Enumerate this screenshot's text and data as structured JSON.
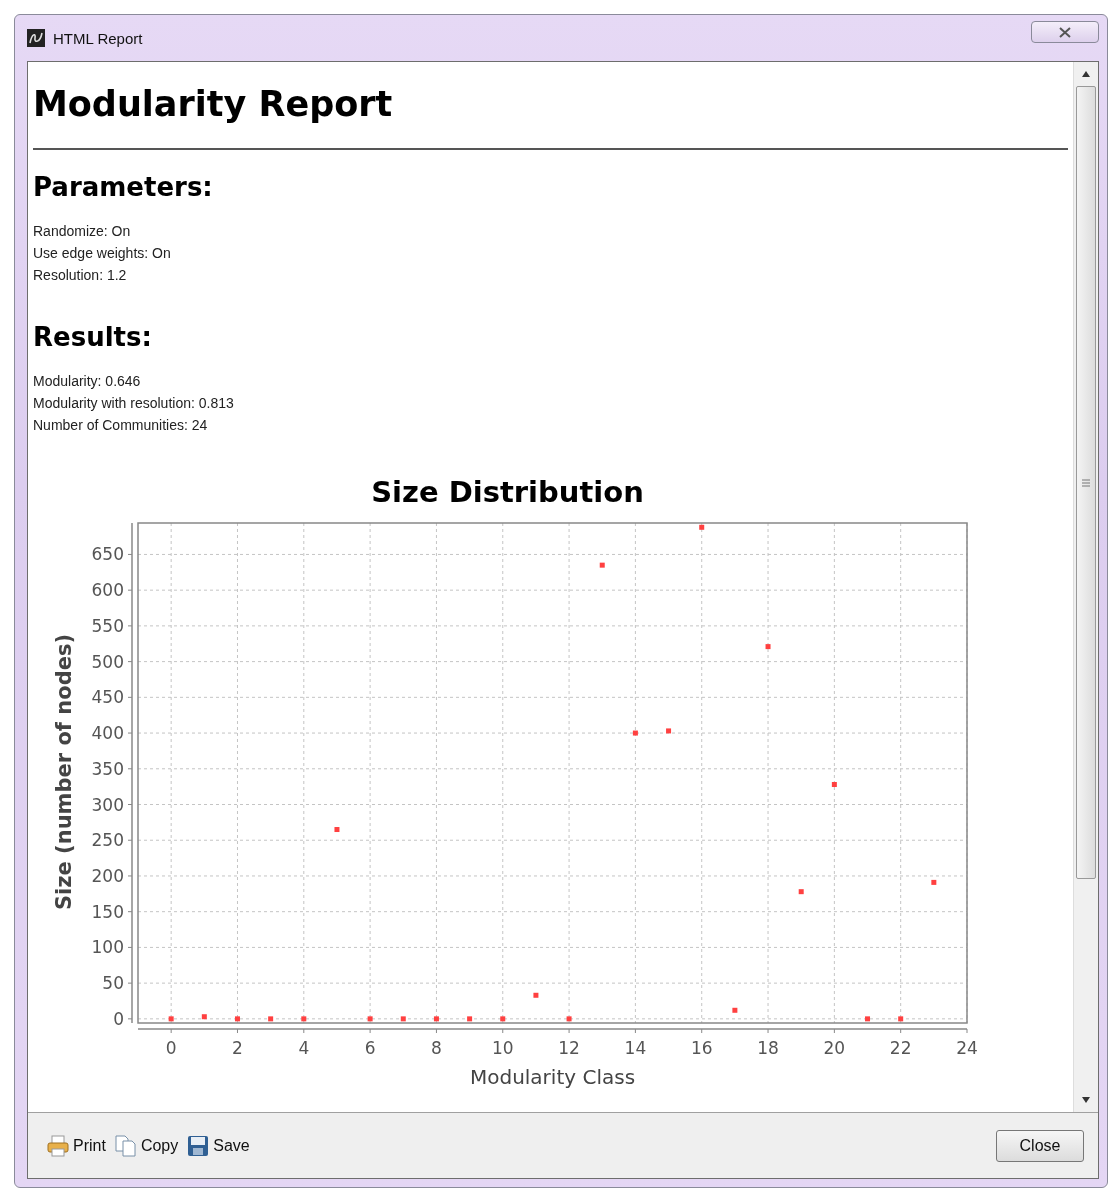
{
  "window": {
    "title": "HTML Report"
  },
  "report": {
    "title": "Modularity Report",
    "sections": [
      {
        "heading": "Parameters:",
        "lines": [
          "Randomize: On",
          "Use edge weights: On",
          "Resolution: 1.2"
        ]
      },
      {
        "heading": "Results:",
        "lines": [
          "Modularity: 0.646",
          "Modularity with resolution: 0.813",
          "Number of Communities: 24"
        ]
      }
    ],
    "chart_data": {
      "type": "scatter",
      "title": "Size Distribution",
      "xlabel": "Modularity Class",
      "ylabel": "Size (number of nodes)",
      "x": [
        0,
        1,
        2,
        3,
        4,
        5,
        6,
        7,
        8,
        9,
        10,
        11,
        12,
        13,
        14,
        15,
        16,
        17,
        18,
        19,
        20,
        21,
        22,
        23
      ],
      "grid": true,
      "series": [
        {
          "color": "#ff4040",
          "values": [
            0,
            3,
            0,
            0,
            0,
            265,
            0,
            0,
            0,
            0,
            0,
            33,
            0,
            635,
            400,
            403,
            688,
            12,
            521,
            178,
            328,
            0,
            0,
            191
          ]
        }
      ],
      "xlim": [
        -1,
        24
      ],
      "ylim": [
        -3,
        694
      ],
      "xticks": [
        0,
        2,
        4,
        6,
        8,
        10,
        12,
        14,
        16,
        18,
        20,
        22,
        24
      ],
      "yticks": [
        0,
        50,
        100,
        150,
        200,
        250,
        300,
        350,
        400,
        450,
        500,
        550,
        600,
        650
      ]
    }
  },
  "toolbar": [
    {
      "kind": "print",
      "label": "Print"
    },
    {
      "kind": "copy",
      "label": "Copy"
    },
    {
      "kind": "save",
      "label": "Save"
    }
  ],
  "close_button": "Close"
}
